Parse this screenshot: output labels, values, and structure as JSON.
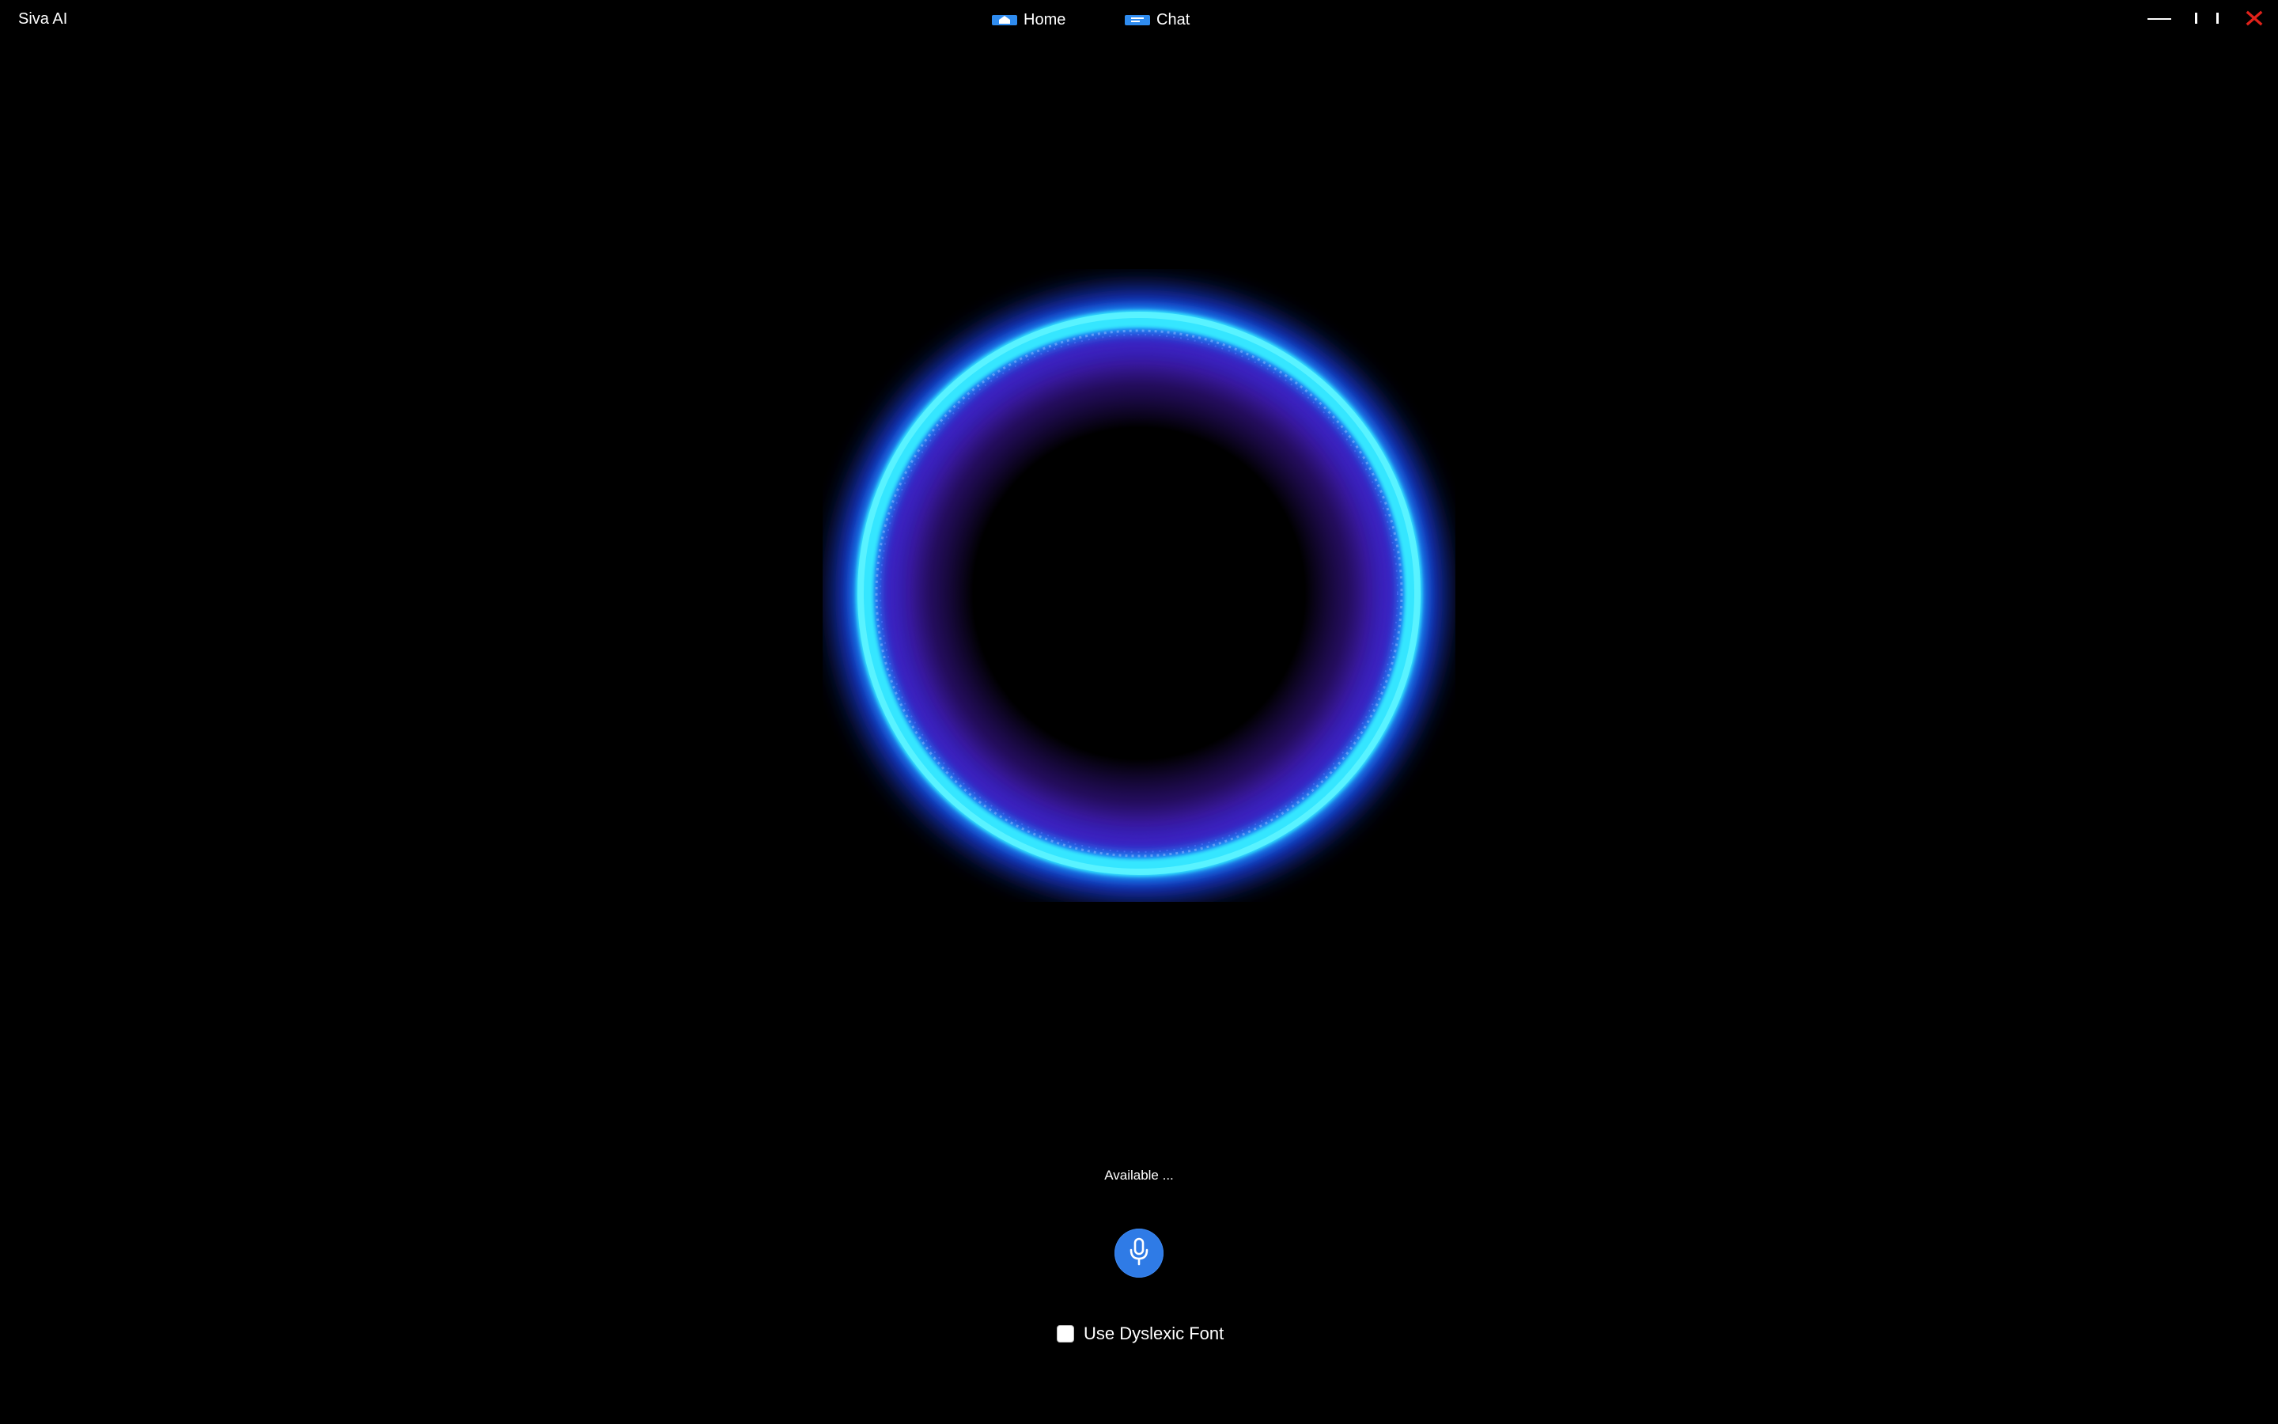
{
  "window": {
    "title": "Siva AI"
  },
  "nav": {
    "items": [
      {
        "label": "Home",
        "icon": "home-icon"
      },
      {
        "label": "Chat",
        "icon": "chat-icon"
      }
    ]
  },
  "window_controls": {
    "minimize_icon": "minimize-icon",
    "maximize_icon": "maximize-icon",
    "close_icon": "close-icon"
  },
  "orb": {
    "ring_color": "#2fe0ff",
    "glow_color": "#1e4dff",
    "inner_color": "#3a1a8c"
  },
  "assistant": {
    "status_text": "Available ...",
    "mic_icon": "microphone-icon",
    "mic_color": "#2f7be6"
  },
  "settings": {
    "dyslexic_font_label": "Use Dyslexic Font",
    "dyslexic_font_checked": false
  },
  "colors": {
    "background": "#000000",
    "close": "#e0221a",
    "nav_icon": "#2f8cf0"
  }
}
